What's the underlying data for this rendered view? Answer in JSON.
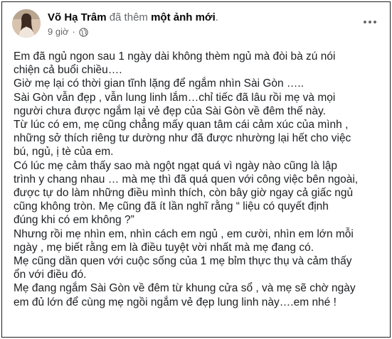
{
  "post": {
    "author": "Võ Hạ Trâm",
    "action_text": "đã thêm",
    "action_object": "một ảnh mới",
    "action_end": ".",
    "time": "9 giờ",
    "separator": "·",
    "privacy_icon": "globe-icon",
    "more_icon": "more-options-icon",
    "lines": [
      "Em đã ngủ ngon sau 1 ngày dài không thèm ngủ mà đòi bà zú nói",
      "chiện cả buổi chiều….",
      "Giờ mẹ lại có thời gian tĩnh lặng để ngắm nhìn Sài Gòn …..",
      "Sài Gòn vẫn đẹp , vẫn lung linh lắm…chỉ tiếc đã lâu rồi mẹ và mọi",
      "người chưa được ngắm lại vẻ đẹp của Sài Gòn về đêm thế này.",
      "Từ lúc có em, mẹ cũng chẳng mấy quan tâm cái cảm xúc của mình ,",
      "những sở thích riêng tư dường như đã được nhường lại hết cho việc",
      "bú, ngủ, ị tè của em.",
      "Có lúc mẹ cảm thấy sao mà ngột ngạt quá vì ngày nào cũng là lập",
      "trình y chang nhau … mà mẹ thì đã quá quen với công việc bên ngoài,",
      "được tự do làm những điều mình thích, còn bây giờ ngay cả giấc ngủ",
      "cũng không tròn. Mẹ cũng đã ít lần nghĩ rằng “ liệu có quyết định",
      "đúng khi có em không ?”",
      "Nhưng rồi mẹ nhìn em, nhìn cách em ngủ , em cười, nhìn em lớn mỗi",
      "ngày , mẹ biết rằng em là điều tuyệt vời nhất mà mẹ đang có.",
      "Mẹ cũng dần quen với cuộc sống của 1 mẹ bỉm thực thụ và cảm thấy",
      "ổn với điều đó.",
      "Mẹ đang ngắm Sài Gòn về đêm từ khung cửa sổ , và mẹ sẽ chờ ngày",
      "em đủ lớn để cùng mẹ ngồi ngắm vẻ đẹp lung linh này….em nhé !"
    ]
  },
  "colors": {
    "text": "#1c1e21",
    "secondary": "#65676b",
    "border": "#1c1e21"
  }
}
